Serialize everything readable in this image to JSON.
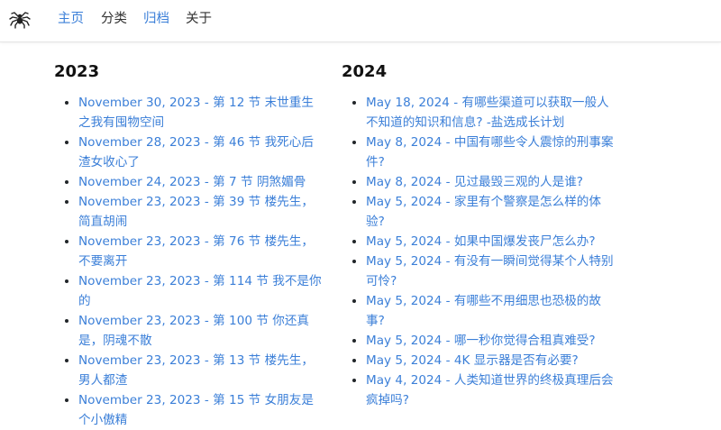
{
  "nav": {
    "logo_icon": "spider-icon",
    "items": [
      {
        "label": "主页",
        "active": true
      },
      {
        "label": "分类",
        "active": false
      },
      {
        "label": "归档",
        "active": true
      },
      {
        "label": "关于",
        "active": false
      }
    ]
  },
  "colors": {
    "link": "#3b7fd8",
    "text": "#333333",
    "heading": "#111111"
  },
  "archive": [
    {
      "year": "2023",
      "posts": [
        {
          "date": "November 30, 2023",
          "sep": " - ",
          "title": "第 12 节 末世重生之我有囤物空间"
        },
        {
          "date": "November 28, 2023",
          "sep": " - ",
          "title": "第 46 节 我死心后渣女收心了"
        },
        {
          "date": "November 24, 2023",
          "sep": " - ",
          "title": "第 7 节 阴煞媚骨"
        },
        {
          "date": "November 23, 2023",
          "sep": " - ",
          "title": "第 39 节 楼先生，简直胡闹"
        },
        {
          "date": "November 23, 2023",
          "sep": " - ",
          "title": "第 76 节 楼先生，不要离开"
        },
        {
          "date": "November 23, 2023",
          "sep": " - ",
          "title": "第 114 节 我不是你的"
        },
        {
          "date": "November 23, 2023",
          "sep": " - ",
          "title": "第 100 节 你还真是，阴魂不散"
        },
        {
          "date": "November 23, 2023",
          "sep": " - ",
          "title": "第 13 节 楼先生，男人都渣"
        },
        {
          "date": "November 23, 2023",
          "sep": " - ",
          "title": "第 15 节 女朋友是个小傲精"
        }
      ]
    },
    {
      "year": "2024",
      "posts": [
        {
          "date": "May 18, 2024",
          "sep": " - ",
          "title": "有哪些渠道可以获取一般人不知道的知识和信息? -盐选成长计划"
        },
        {
          "date": "May 8, 2024",
          "sep": " - ",
          "title": "中国有哪些令人震惊的刑事案件?"
        },
        {
          "date": "May 8, 2024",
          "sep": " - ",
          "title": "见过最毁三观的人是谁?"
        },
        {
          "date": "May 5, 2024",
          "sep": " - ",
          "title": "家里有个警察是怎么样的体验?"
        },
        {
          "date": "May 5, 2024",
          "sep": " - ",
          "title": "如果中国爆发丧尸怎么办?"
        },
        {
          "date": "May 5, 2024",
          "sep": " - ",
          "title": "有没有一瞬间觉得某个人特别可怜?"
        },
        {
          "date": "May 5, 2024",
          "sep": " - ",
          "title": "有哪些不用细思也恐极的故事?"
        },
        {
          "date": "May 5, 2024",
          "sep": " - ",
          "title": "哪一秒你觉得合租真难受?"
        },
        {
          "date": "May 5, 2024",
          "sep": " - ",
          "title": "4K 显示器是否有必要?"
        },
        {
          "date": "May 4, 2024",
          "sep": " - ",
          "title": "人类知道世界的终极真理后会疯掉吗?"
        }
      ]
    }
  ]
}
